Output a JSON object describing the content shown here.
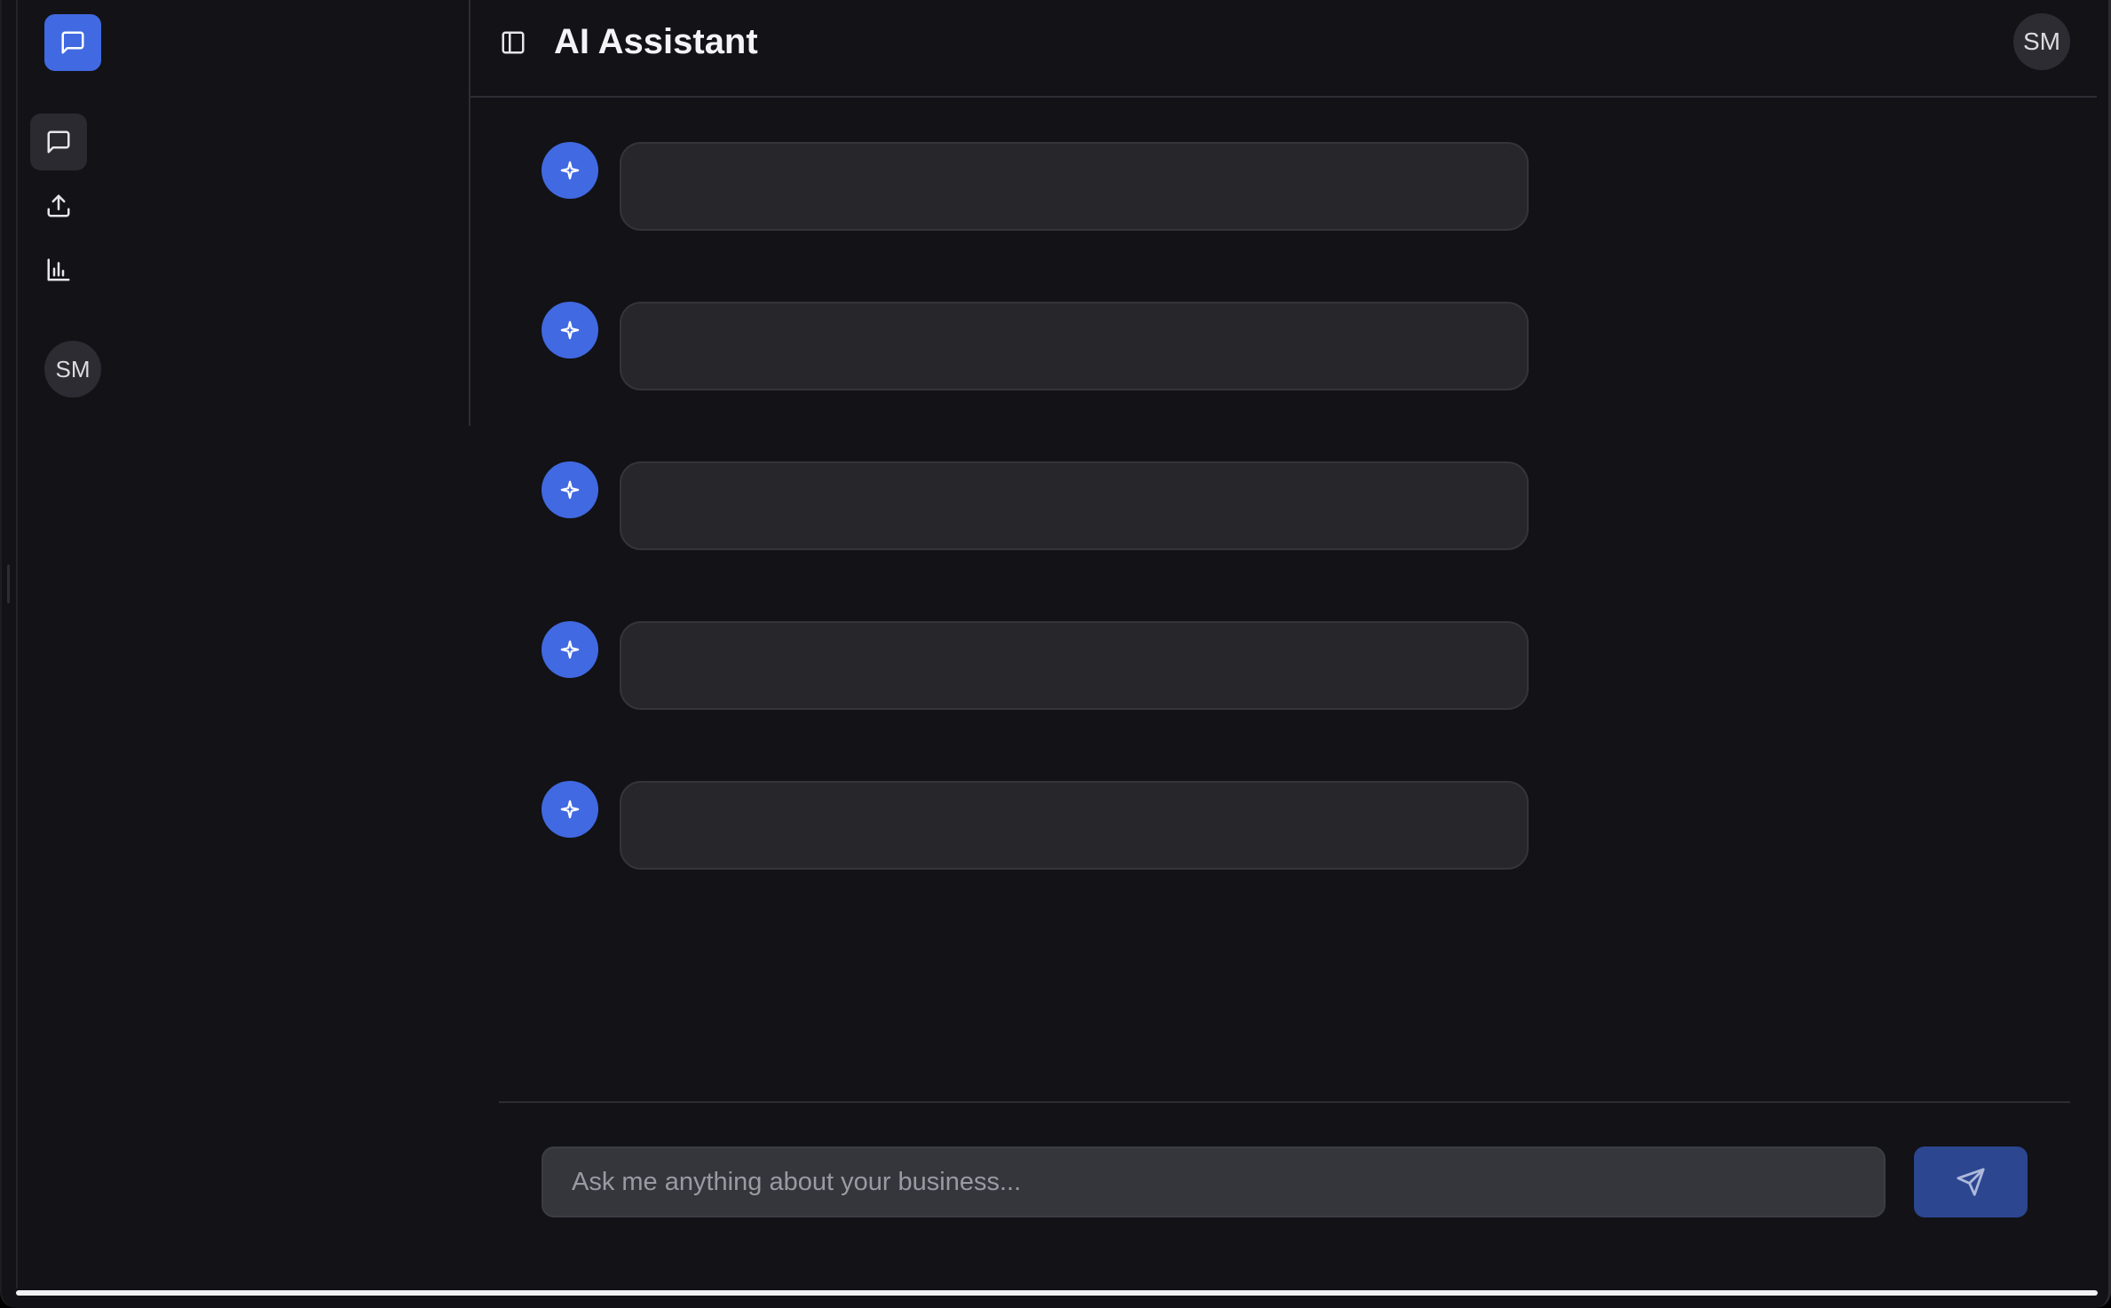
{
  "header": {
    "title": "AI Assistant",
    "avatar_initials": "SM"
  },
  "sidebar": {
    "logo_icon": "message-square-icon",
    "items": [
      {
        "icon": "chat-icon",
        "active": true
      },
      {
        "icon": "upload-icon",
        "active": false
      },
      {
        "icon": "bar-chart-icon",
        "active": false
      }
    ],
    "avatar_initials": "SM"
  },
  "messages": [
    {
      "role": "assistant",
      "state": "loading"
    },
    {
      "role": "assistant",
      "state": "loading"
    },
    {
      "role": "assistant",
      "state": "loading"
    },
    {
      "role": "assistant",
      "state": "loading"
    },
    {
      "role": "assistant",
      "state": "loading"
    }
  ],
  "composer": {
    "placeholder": "Ask me anything about your business...",
    "value": "",
    "send_icon": "send-icon"
  },
  "colors": {
    "background": "#121217",
    "accent": "#4169e1",
    "send_button": "#2c4690",
    "bubble": "#26262b"
  }
}
